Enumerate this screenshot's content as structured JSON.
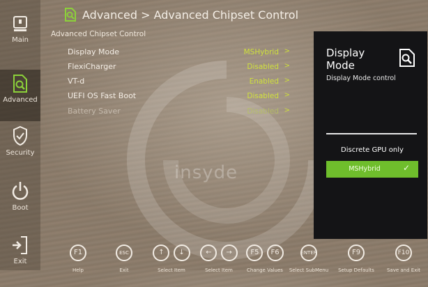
{
  "sidebar": {
    "items": [
      {
        "label": "Main",
        "icon": "main-icon"
      },
      {
        "label": "Advanced",
        "icon": "advanced-icon",
        "active": true
      },
      {
        "label": "Security",
        "icon": "shield-icon"
      },
      {
        "label": "Boot",
        "icon": "power-icon"
      },
      {
        "label": "Exit",
        "icon": "exit-door-icon"
      }
    ]
  },
  "header": {
    "breadcrumb": "Advanced > Advanced Chipset Control",
    "icon": "magnify-document-icon"
  },
  "section_title": "Advanced Chipset Control",
  "settings": [
    {
      "label": "Display Mode",
      "value": "MSHybrid",
      "arrow": ">"
    },
    {
      "label": "FlexiCharger",
      "value": "Disabled",
      "arrow": ">"
    },
    {
      "label": "VT-d",
      "value": "Enabled",
      "arrow": ">"
    },
    {
      "label": "UEFI OS Fast Boot",
      "value": "Disabled",
      "arrow": ">"
    },
    {
      "label": "Battery Saver",
      "value": "Disabled",
      "arrow": ">"
    }
  ],
  "watermark": "insyde",
  "help_panel": {
    "title": "Display Mode",
    "description": "Display Mode control",
    "option_label": "Discrete GPU only",
    "selected_option": "MSHybrid",
    "check": "✓"
  },
  "footer": {
    "keys": [
      {
        "key": "F1",
        "label": "Help"
      },
      {
        "key": "ESC",
        "label": "Exit"
      },
      {
        "key": "↑↓",
        "label": "Select Item"
      },
      {
        "key": "←→",
        "label": "Select Item"
      },
      {
        "key": "F5F6",
        "label": "Change Values"
      },
      {
        "key": "ENTER",
        "label": "Select SubMenu"
      },
      {
        "key": "F9",
        "label": "Setup Defaults"
      },
      {
        "key": "F10",
        "label": "Save and Exit"
      }
    ]
  },
  "colors": {
    "value_accent": "#cfe03c",
    "selected_option_bg": "#6fbe2c",
    "panel_bg": "#141416"
  }
}
